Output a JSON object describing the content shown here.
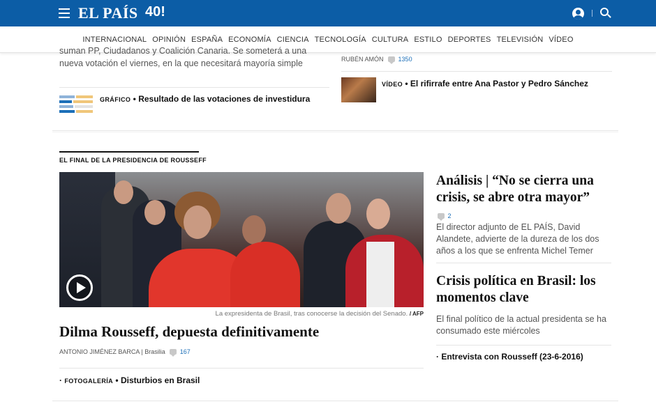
{
  "header": {
    "logo": "EL PAÍS",
    "logo_badge": "40!",
    "colors": {
      "bar": "#0c5da6",
      "link": "#1c6fb8"
    }
  },
  "nav": {
    "items": [
      "INTERNACIONAL",
      "OPINIÓN",
      "ESPAÑA",
      "ECONOMÍA",
      "CIENCIA",
      "TECNOLOGÍA",
      "CULTURA",
      "ESTILO",
      "DEPORTES",
      "TELEVISIÓN",
      "VÍDEO"
    ]
  },
  "top_block": {
    "lead_text": "suman PP, Ciudadanos y Coalición Canaria. Se someterá a una nueva votación el viernes, en la que necesitará mayoría simple",
    "grafico_kicker": "GRÁFICO",
    "grafico_title": "Resultado de las votaciones de investidura",
    "author": "RUBÉN AMÓN",
    "author_comments": "1350",
    "video_kicker": "VÍDEO",
    "video_title": "El rifirrafe entre Ana Pastor y Pedro Sánchez"
  },
  "section": {
    "label": "EL FINAL DE LA PRESIDENCIA DE ROUSSEFF"
  },
  "main_story": {
    "caption": "La expresidenta de Brasil, tras conocerse la decisión del Senado.",
    "credit": "/ AFP",
    "headline": "Dilma Rousseff, depuesta definitivamente",
    "byline": "ANTONIO JIMÉNEZ BARCA | Brasilia",
    "comments": "167",
    "gallery_kicker": "FOTOGALERÍA",
    "gallery_title": "Disturbios en Brasil"
  },
  "right_column": {
    "story1_headline": "Análisis | “No se cierra una crisis, se abre otra mayor”",
    "story1_comments": "2",
    "story1_text": "El director adjunto de EL PAÍS, David Alandete, advierte de la dureza de los dos años a los que se enfrenta Michel Temer",
    "story2_headline": "Crisis política en Brasil: los momentos clave",
    "story2_text": "El final político de la actual presidenta se ha consumado este miércoles",
    "related_item": "Entrevista con Rousseff (23-6-2016)"
  }
}
